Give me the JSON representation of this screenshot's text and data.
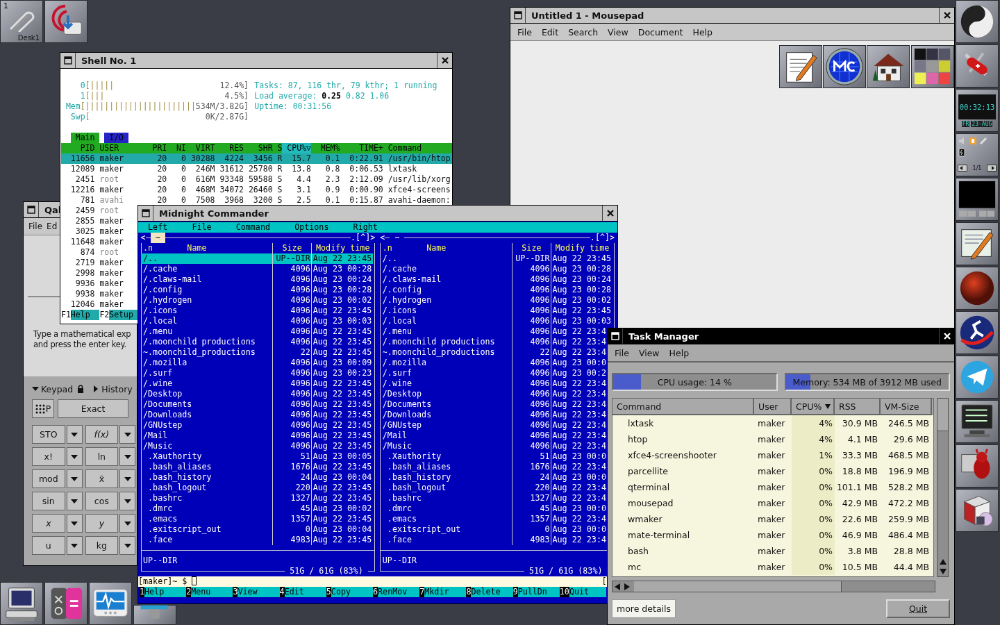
{
  "desktop": {
    "clip": {
      "workspace": "1",
      "label": "Desk1"
    }
  },
  "dock": {
    "clock": {
      "time": "00:32:13",
      "day": "FR",
      "date": "23-AUG"
    },
    "pager": "1/1"
  },
  "mousepad": {
    "title": "Untitled 1 - Mousepad",
    "focused": false,
    "menu": [
      "File",
      "Edit",
      "Search",
      "View",
      "Document",
      "Help"
    ]
  },
  "qalculate": {
    "title": "Qal",
    "focused": false,
    "menu": [
      "File",
      "Ed"
    ],
    "hint": [
      "Type a mathematical exp",
      "and press the enter key."
    ],
    "sections": [
      {
        "label": "Keypad",
        "expanded": true
      },
      {
        "label": "History",
        "expanded": false
      }
    ],
    "mode_buttons": [
      "P",
      "Exact"
    ],
    "keys": [
      [
        {
          "label": "STO",
          "italic": false
        },
        {
          "label": "f(x)",
          "italic": true
        }
      ],
      [
        {
          "label": "x!",
          "italic": false
        },
        {
          "label": "ln",
          "italic": false
        }
      ],
      [
        {
          "label": "mod",
          "italic": false
        },
        {
          "label": "x̄",
          "italic": false
        }
      ],
      [
        {
          "label": "sin",
          "italic": false
        },
        {
          "label": "cos",
          "italic": false
        }
      ],
      [
        {
          "label": "x",
          "italic": true
        },
        {
          "label": "y",
          "italic": true
        }
      ],
      [
        {
          "label": "u",
          "italic": false
        },
        {
          "label": "kg",
          "italic": false
        }
      ]
    ]
  },
  "shell": {
    "title": "Shell No. 1",
    "focused": false,
    "meters": [
      {
        "label": "0",
        "bar": "[|||||",
        "value": "12.4%]"
      },
      {
        "label": "1",
        "bar": "[|||",
        "value": "4.5%]"
      },
      {
        "label": "Mem",
        "bar": "[|||||||||||||||||||||||",
        "value": "534M/3.82G]"
      },
      {
        "label": "Swp",
        "bar": "[",
        "value": "0K/2.87G]"
      }
    ],
    "info": [
      "Tasks: 87, 116 thr, 79 kthr; 1 running",
      "Load average: **0.25** 0.82 1.06",
      "Uptime: 00:31:56"
    ],
    "tabs": [
      {
        "label": "Main",
        "selected": true
      },
      {
        "label": "I/O",
        "selected": false
      }
    ],
    "columns": [
      {
        "label": "PID",
        "selected": false
      },
      {
        "label": "USER",
        "selected": false
      },
      {
        "label": "PRI",
        "selected": false
      },
      {
        "label": "NI",
        "selected": false
      },
      {
        "label": "VIRT",
        "selected": false
      },
      {
        "label": "RES",
        "selected": false
      },
      {
        "label": "SHR",
        "selected": false
      },
      {
        "label": "S",
        "selected": false
      },
      {
        "label": "CPU%▽",
        "selected": true
      },
      {
        "label": "MEM%",
        "selected": false
      },
      {
        "label": "TIME+",
        "selected": false
      },
      {
        "label": "Command",
        "selected": false
      }
    ],
    "processes": [
      {
        "pid": "11656",
        "user": "maker",
        "system": false,
        "selected": true,
        "pri": "20",
        "ni": "0",
        "virt": "30288",
        "res": "4224",
        "shr": "3456",
        "s": "R",
        "cpu": "15.7",
        "mem": "0.1",
        "time": "0:22.91",
        "command": "/usr/bin/htop"
      },
      {
        "pid": "12089",
        "user": "maker",
        "system": false,
        "selected": false,
        "pri": "20",
        "ni": "0",
        "virt": "246M",
        "res": "31612",
        "shr": "25780",
        "s": "R",
        "cpu": "13.8",
        "mem": "0.8",
        "time": "0:06.53",
        "command": "lxtask"
      },
      {
        "pid": "2451",
        "user": "root",
        "system": true,
        "selected": false,
        "pri": "20",
        "ni": "0",
        "virt": "616M",
        "res": "93348",
        "shr": "59588",
        "s": "S",
        "cpu": "4.4",
        "mem": "2.3",
        "time": "2:12.09",
        "command": "/usr/lib/xorg"
      },
      {
        "pid": "12216",
        "user": "maker",
        "system": false,
        "selected": false,
        "pri": "20",
        "ni": "0",
        "virt": "468M",
        "res": "34072",
        "shr": "26460",
        "s": "S",
        "cpu": "3.1",
        "mem": "0.9",
        "time": "0:00.90",
        "command": "xfce4-screens"
      },
      {
        "pid": "781",
        "user": "avahi",
        "system": true,
        "selected": false,
        "pri": "20",
        "ni": "0",
        "virt": "7508",
        "res": "3968",
        "shr": "3200",
        "s": "S",
        "cpu": "2.5",
        "mem": "0.1",
        "time": "0:15.87",
        "command": "avahi-daemon:"
      },
      {
        "pid": "2459",
        "user": "root",
        "system": true,
        "selected": false
      },
      {
        "pid": "2855",
        "user": "maker",
        "system": false,
        "selected": false
      },
      {
        "pid": "3025",
        "user": "maker",
        "system": false,
        "selected": false
      },
      {
        "pid": "11648",
        "user": "maker",
        "system": false,
        "selected": false
      },
      {
        "pid": "874",
        "user": "root",
        "system": true,
        "selected": false
      },
      {
        "pid": "2719",
        "user": "maker",
        "system": false,
        "selected": false
      },
      {
        "pid": "2998",
        "user": "maker",
        "system": false,
        "selected": false
      },
      {
        "pid": "9936",
        "user": "maker",
        "system": false,
        "selected": false
      },
      {
        "pid": "9938",
        "user": "maker",
        "system": false,
        "selected": false
      },
      {
        "pid": "12046",
        "user": "maker",
        "system": false,
        "selected": false
      }
    ],
    "keys": [
      {
        "key": "F1",
        "label": "Help"
      },
      {
        "key": "F2",
        "label": "Setup"
      }
    ]
  },
  "mc": {
    "title": "Midnight Commander",
    "focused": false,
    "menu": [
      "Left",
      "File",
      "Command",
      "Options",
      "Right"
    ],
    "panels": [
      {
        "active": true,
        "nav_left": "<",
        "path": "~",
        "nav_right": ".[^]>",
        "columns": [
          ".n",
          "Name",
          "Size",
          "Modify time"
        ],
        "rows": [
          {
            "name": "/..",
            "kind": "dir",
            "size": "UP--DIR",
            "time": "Aug 22 23:45",
            "selected": true
          },
          {
            "name": "/.cache",
            "kind": "dir",
            "size": "4096",
            "time": "Aug 23 00:28",
            "selected": false
          },
          {
            "name": "/.claws-mail",
            "kind": "dir",
            "size": "4096",
            "time": "Aug 23 00:24",
            "selected": false
          },
          {
            "name": "/.config",
            "kind": "dir",
            "size": "4096",
            "time": "Aug 23 00:28",
            "selected": false
          },
          {
            "name": "/.hydrogen",
            "kind": "dir",
            "size": "4096",
            "time": "Aug 23 00:02",
            "selected": false
          },
          {
            "name": "/.icons",
            "kind": "dir",
            "size": "4096",
            "time": "Aug 22 23:45",
            "selected": false
          },
          {
            "name": "/.local",
            "kind": "dir",
            "size": "4096",
            "time": "Aug 23 00:03",
            "selected": false
          },
          {
            "name": "/.menu",
            "kind": "dir",
            "size": "4096",
            "time": "Aug 22 23:45",
            "selected": false
          },
          {
            "name": "/.moonchild productions",
            "kind": "dir",
            "size": "4096",
            "time": "Aug 22 23:45",
            "selected": false
          },
          {
            "name": "~.moonchild_productions",
            "kind": "dir",
            "size": "22",
            "time": "Aug 22 23:45",
            "selected": false
          },
          {
            "name": "/.mozilla",
            "kind": "dir",
            "size": "4096",
            "time": "Aug 23 00:09",
            "selected": false
          },
          {
            "name": "/.surf",
            "kind": "dir",
            "size": "4096",
            "time": "Aug 23 00:23",
            "selected": false
          },
          {
            "name": "/.wine",
            "kind": "dir",
            "size": "4096",
            "time": "Aug 22 23:45",
            "selected": false
          },
          {
            "name": "/Desktop",
            "kind": "dir",
            "size": "4096",
            "time": "Aug 22 23:45",
            "selected": false
          },
          {
            "name": "/Documents",
            "kind": "dir",
            "size": "4096",
            "time": "Aug 22 23:45",
            "selected": false
          },
          {
            "name": "/Downloads",
            "kind": "dir",
            "size": "4096",
            "time": "Aug 22 23:45",
            "selected": false
          },
          {
            "name": "/GNUstep",
            "kind": "dir",
            "size": "4096",
            "time": "Aug 22 23:45",
            "selected": false
          },
          {
            "name": "/Mail",
            "kind": "dir",
            "size": "4096",
            "time": "Aug 22 23:45",
            "selected": false
          },
          {
            "name": "/Music",
            "kind": "dir",
            "size": "4096",
            "time": "Aug 22 23:45",
            "selected": false
          },
          {
            "name": ".Xauthority",
            "kind": "file",
            "size": "51",
            "time": "Aug 23 00:05",
            "selected": false
          },
          {
            "name": ".bash_aliases",
            "kind": "file",
            "size": "1676",
            "time": "Aug 22 23:45",
            "selected": false
          },
          {
            "name": ".bash_history",
            "kind": "file",
            "size": "24",
            "time": "Aug 23 00:04",
            "selected": false
          },
          {
            "name": ".bash_logout",
            "kind": "file",
            "size": "220",
            "time": "Aug 22 23:45",
            "selected": false
          },
          {
            "name": ".bashrc",
            "kind": "file",
            "size": "1327",
            "time": "Aug 22 23:45",
            "selected": false
          },
          {
            "name": ".dmrc",
            "kind": "file",
            "size": "45",
            "time": "Aug 23 00:02",
            "selected": false
          },
          {
            "name": ".emacs",
            "kind": "file",
            "size": "1357",
            "time": "Aug 22 23:45",
            "selected": false
          },
          {
            "name": ".exitscript_out",
            "kind": "file",
            "size": "0",
            "time": "Aug 23 00:04",
            "selected": false
          },
          {
            "name": ".face",
            "kind": "file",
            "size": "4983",
            "time": "Aug 22 23:45",
            "selected": false
          }
        ],
        "status": "UP--DIR",
        "disk": "51G / 61G (83%)"
      },
      {
        "active": false,
        "nav_left": "<",
        "path": "~",
        "nav_right": ".[^]>",
        "columns": [
          ".n",
          "Name",
          "Size",
          "Modify time"
        ],
        "rows": [
          {
            "name": "/..",
            "kind": "dir",
            "size": "UP--DIR",
            "time": "Aug 22 23:45",
            "selected": false
          },
          {
            "name": "/.cache",
            "kind": "dir",
            "size": "4096",
            "time": "Aug 23 00:28",
            "selected": false
          },
          {
            "name": "/.claws-mail",
            "kind": "dir",
            "size": "4096",
            "time": "Aug 23 00:24",
            "selected": false
          },
          {
            "name": "/.config",
            "kind": "dir",
            "size": "4096",
            "time": "Aug 23 00:28",
            "selected": false
          },
          {
            "name": "/.hydrogen",
            "kind": "dir",
            "size": "4096",
            "time": "Aug 23 00:02",
            "selected": false
          },
          {
            "name": "/.icons",
            "kind": "dir",
            "size": "4096",
            "time": "Aug 22 23:45",
            "selected": false
          },
          {
            "name": "/.local",
            "kind": "dir",
            "size": "4096",
            "time": "Aug 23 00:03",
            "selected": false
          },
          {
            "name": "/.menu",
            "kind": "dir",
            "size": "4096",
            "time": "Aug 22 23:4",
            "selected": false
          },
          {
            "name": "/.moonchild productions",
            "kind": "dir",
            "size": "4096",
            "time": "Aug 22 23:4",
            "selected": false
          },
          {
            "name": "~.moonchild_productions",
            "kind": "dir",
            "size": "22",
            "time": "Aug 22 23:4",
            "selected": false
          },
          {
            "name": "/.mozilla",
            "kind": "dir",
            "size": "4096",
            "time": "Aug 23 00:0",
            "selected": false
          },
          {
            "name": "/.surf",
            "kind": "dir",
            "size": "4096",
            "time": "Aug 23 00:2",
            "selected": false
          },
          {
            "name": "/.wine",
            "kind": "dir",
            "size": "4096",
            "time": "Aug 22 23:4",
            "selected": false
          },
          {
            "name": "/Desktop",
            "kind": "dir",
            "size": "4096",
            "time": "Aug 22 23:4",
            "selected": false
          },
          {
            "name": "/Documents",
            "kind": "dir",
            "size": "4096",
            "time": "Aug 22 23:4",
            "selected": false
          },
          {
            "name": "/Downloads",
            "kind": "dir",
            "size": "4096",
            "time": "Aug 22 23:4",
            "selected": false
          },
          {
            "name": "/GNUstep",
            "kind": "dir",
            "size": "4096",
            "time": "Aug 22 23:4",
            "selected": false
          },
          {
            "name": "/Mail",
            "kind": "dir",
            "size": "4096",
            "time": "Aug 22 23:4",
            "selected": false
          },
          {
            "name": "/Music",
            "kind": "dir",
            "size": "4096",
            "time": "Aug 22 23:4",
            "selected": false
          },
          {
            "name": ".Xauthority",
            "kind": "file",
            "size": "51",
            "time": "Aug 23 00:0",
            "selected": false
          },
          {
            "name": ".bash_aliases",
            "kind": "file",
            "size": "1676",
            "time": "Aug 22 23:4",
            "selected": false
          },
          {
            "name": ".bash_history",
            "kind": "file",
            "size": "24",
            "time": "Aug 23 00:0",
            "selected": false
          },
          {
            "name": ".bash_logout",
            "kind": "file",
            "size": "220",
            "time": "Aug 22 23:4",
            "selected": false
          },
          {
            "name": ".bashrc",
            "kind": "file",
            "size": "1327",
            "time": "Aug 22 23:4",
            "selected": false
          },
          {
            "name": ".dmrc",
            "kind": "file",
            "size": "45",
            "time": "Aug 23 00:0",
            "selected": false
          },
          {
            "name": ".emacs",
            "kind": "file",
            "size": "1357",
            "time": "Aug 22 23:4",
            "selected": false
          },
          {
            "name": ".exitscript_out",
            "kind": "file",
            "size": "0",
            "time": "Aug 23 00:0",
            "selected": false
          },
          {
            "name": ".face",
            "kind": "file",
            "size": "4983",
            "time": "Aug 22 23:4",
            "selected": false
          }
        ],
        "status": "UP--DIR",
        "disk": "51G / 61G (83%)"
      }
    ],
    "prompt": "[maker]~ $",
    "hint": "[",
    "keys": [
      {
        "key": "1",
        "label": "Help"
      },
      {
        "key": "2",
        "label": "Menu"
      },
      {
        "key": "3",
        "label": "View"
      },
      {
        "key": "4",
        "label": "Edit"
      },
      {
        "key": "5",
        "label": "Copy"
      },
      {
        "key": "6",
        "label": "RenMov"
      },
      {
        "key": "7",
        "label": "Mkdir"
      },
      {
        "key": "8",
        "label": "Delete"
      },
      {
        "key": "9",
        "label": "PullDn"
      },
      {
        "key": "10",
        "label": "Quit"
      }
    ]
  },
  "task_manager": {
    "title": "Task Manager",
    "focused": true,
    "menu": [
      "File",
      "View",
      "Help"
    ],
    "cpu": {
      "label": "CPU usage: 14 %",
      "level": 0.17
    },
    "memory": {
      "label": "Memory: 534 MB of 3912 MB used",
      "level": 0.15
    },
    "columns": [
      {
        "label": "Command",
        "selected": false
      },
      {
        "label": "User",
        "selected": false
      },
      {
        "label": "CPU%",
        "selected": true
      },
      {
        "label": "RSS",
        "selected": false
      },
      {
        "label": "VM-Size",
        "selected": false
      }
    ],
    "rows": [
      {
        "command": "lxtask",
        "user": "maker",
        "cpu": "4%",
        "rss": "30.9 MB",
        "vm": "246.5 MB"
      },
      {
        "command": "htop",
        "user": "maker",
        "cpu": "4%",
        "rss": "4.1 MB",
        "vm": "29.6 MB"
      },
      {
        "command": "xfce4-screenshooter",
        "user": "maker",
        "cpu": "1%",
        "rss": "33.3 MB",
        "vm": "468.5 MB"
      },
      {
        "command": "parcellite",
        "user": "maker",
        "cpu": "0%",
        "rss": "18.8 MB",
        "vm": "196.9 MB"
      },
      {
        "command": "qterminal",
        "user": "maker",
        "cpu": "0%",
        "rss": "101.1 MB",
        "vm": "528.2 MB"
      },
      {
        "command": "mousepad",
        "user": "maker",
        "cpu": "0%",
        "rss": "42.9 MB",
        "vm": "472.2 MB"
      },
      {
        "command": "wmaker",
        "user": "maker",
        "cpu": "0%",
        "rss": "22.6 MB",
        "vm": "259.9 MB"
      },
      {
        "command": "mate-terminal",
        "user": "maker",
        "cpu": "0%",
        "rss": "46.9 MB",
        "vm": "486.4 MB"
      },
      {
        "command": "bash",
        "user": "maker",
        "cpu": "0%",
        "rss": "3.8 MB",
        "vm": "28.8 MB"
      },
      {
        "command": "mc",
        "user": "maker",
        "cpu": "0%",
        "rss": "10.5 MB",
        "vm": "44.4 MB"
      }
    ],
    "buttons": [
      "more details",
      "Quit"
    ]
  }
}
